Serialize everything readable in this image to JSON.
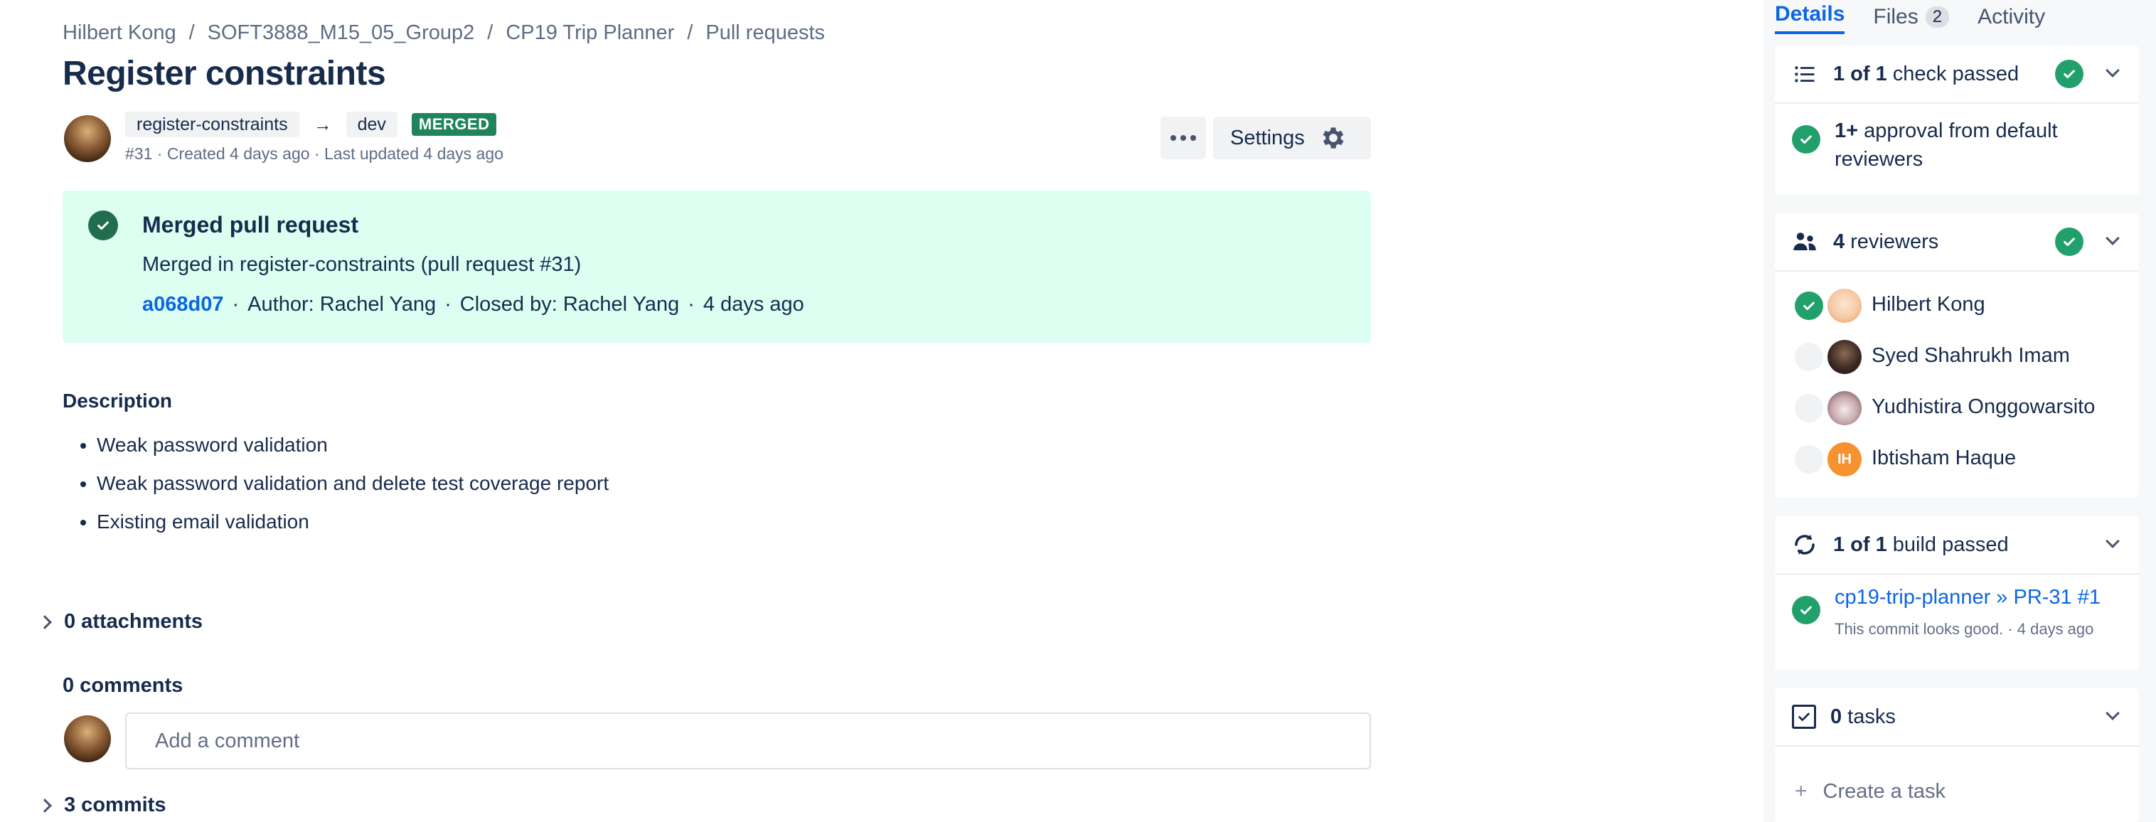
{
  "breadcrumb": [
    "Hilbert Kong",
    "SOFT3888_M15_05_Group2",
    "CP19 Trip Planner",
    "Pull requests"
  ],
  "pr": {
    "title": "Register constraints",
    "source_branch": "register-constraints",
    "target_branch": "dev",
    "status_badge": "MERGED",
    "meta": "#31 · Created 4 days ago · Last updated 4 days ago"
  },
  "actions": {
    "settings_label": "Settings"
  },
  "merged": {
    "title": "Merged pull request",
    "subtitle": "Merged in register-constraints (pull request #31)",
    "commit_hash": "a068d07",
    "author": "Author: Rachel Yang",
    "closed_by": "Closed by: Rachel Yang",
    "time": "4 days ago"
  },
  "description": {
    "heading": "Description",
    "items": [
      "Weak password validation",
      "Weak password validation and delete test coverage report",
      "Existing email validation"
    ]
  },
  "attachments_label": "0 attachments",
  "comments": {
    "heading": "0 comments",
    "placeholder": "Add a comment"
  },
  "commits_label": "3 commits",
  "right_panel": {
    "tabs": [
      {
        "label": "Details"
      },
      {
        "label": "Files",
        "count": "2"
      },
      {
        "label": "Activity"
      }
    ],
    "checks": {
      "count_bold": "1 of 1",
      "label": "check passed",
      "approval_bold": "1+",
      "approval_text": "approval from default reviewers"
    },
    "reviewers": {
      "count_bold": "4",
      "label": "reviewers",
      "list": [
        {
          "name": "Hilbert Kong",
          "approved": true
        },
        {
          "name": "Syed Shahrukh Imam",
          "approved": false
        },
        {
          "name": "Yudhistira Onggowarsito",
          "approved": false
        },
        {
          "name": "Ibtisham Haque",
          "approved": false,
          "initials": "IH"
        }
      ]
    },
    "builds": {
      "count_bold": "1 of 1",
      "label": "build passed",
      "item_link": "cp19-trip-planner » PR-31 #1",
      "item_sub": "This commit looks good.  ·  4 days ago"
    },
    "tasks": {
      "count_bold": "0",
      "label": "tasks",
      "create_label": "Create a task"
    }
  },
  "colors": {
    "accent": "#0c66e4",
    "success": "#22a06b",
    "merged_bg": "#dcfff1",
    "merged_badge": "#1f845a"
  }
}
